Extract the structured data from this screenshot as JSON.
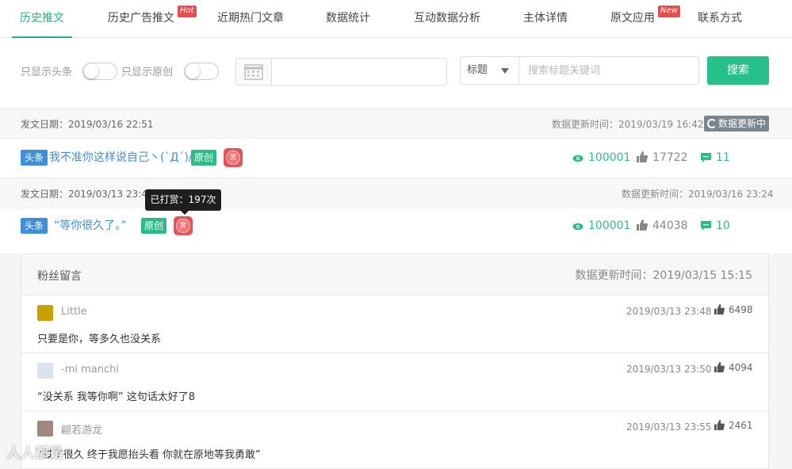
{
  "tabs": [
    {
      "label": "历史推文",
      "active": true
    },
    {
      "label": "历史广告推文",
      "badge": "Hot"
    },
    {
      "label": "近期热门文章"
    },
    {
      "label": "数据统计"
    },
    {
      "label": "互动数据分析"
    },
    {
      "label": "主体详情"
    },
    {
      "label": "原文应用",
      "badge": "New"
    },
    {
      "label": "联系方式"
    }
  ],
  "filters": {
    "only_headline_label": "只显示头条",
    "only_original_label": "只显示原创",
    "search_type": "标题",
    "search_placeholder": "搜索标题关键词",
    "search_button": "搜索"
  },
  "articles": [
    {
      "pub_date": "发文日期：2019/03/16 22:51",
      "update_time": "数据更新时间：2019/03/19 16:42",
      "updating_label": "数据更新中",
      "tag": "头条",
      "title": "我不准你这样说自己丶(`Д´)/",
      "original_tag": "原创",
      "reward_icon": "赏",
      "reads": "100001",
      "likes": "17722",
      "comments": "11"
    },
    {
      "pub_date": "发文日期：2019/03/13 23:45",
      "update_time": "数据更新时间：2019/03/16 23:24",
      "tag": "头条",
      "title": "“等你很久了。”",
      "original_tag": "原创",
      "reward_icon": "赏",
      "reward_tooltip": "已打赏：197次",
      "reads": "100001",
      "likes": "44038",
      "comments": "10"
    }
  ],
  "comments_panel": {
    "title": "粉丝留言",
    "update_time": "数据更新时间：2019/03/15 15:15",
    "items": [
      {
        "name": "Little",
        "time": "2019/03/13 23:48",
        "likes": "6498",
        "text": "只要是你，等多久也没关系",
        "avatar_color": "#c8a000"
      },
      {
        "name": "-mi manchi",
        "time": "2019/03/13 23:50",
        "likes": "4094",
        "text": "“没关系 我等你啊” 这句话太好了8",
        "avatar_color": "#dde3ee"
      },
      {
        "name": "翩若游龙",
        "time": "2019/03/13 23:55",
        "likes": "2461",
        "text": "“过了很久 终于我愿抬头看 你就在原地等我勇敢”",
        "avatar_color": "#a0887a"
      }
    ]
  },
  "watermark": "人人都是"
}
